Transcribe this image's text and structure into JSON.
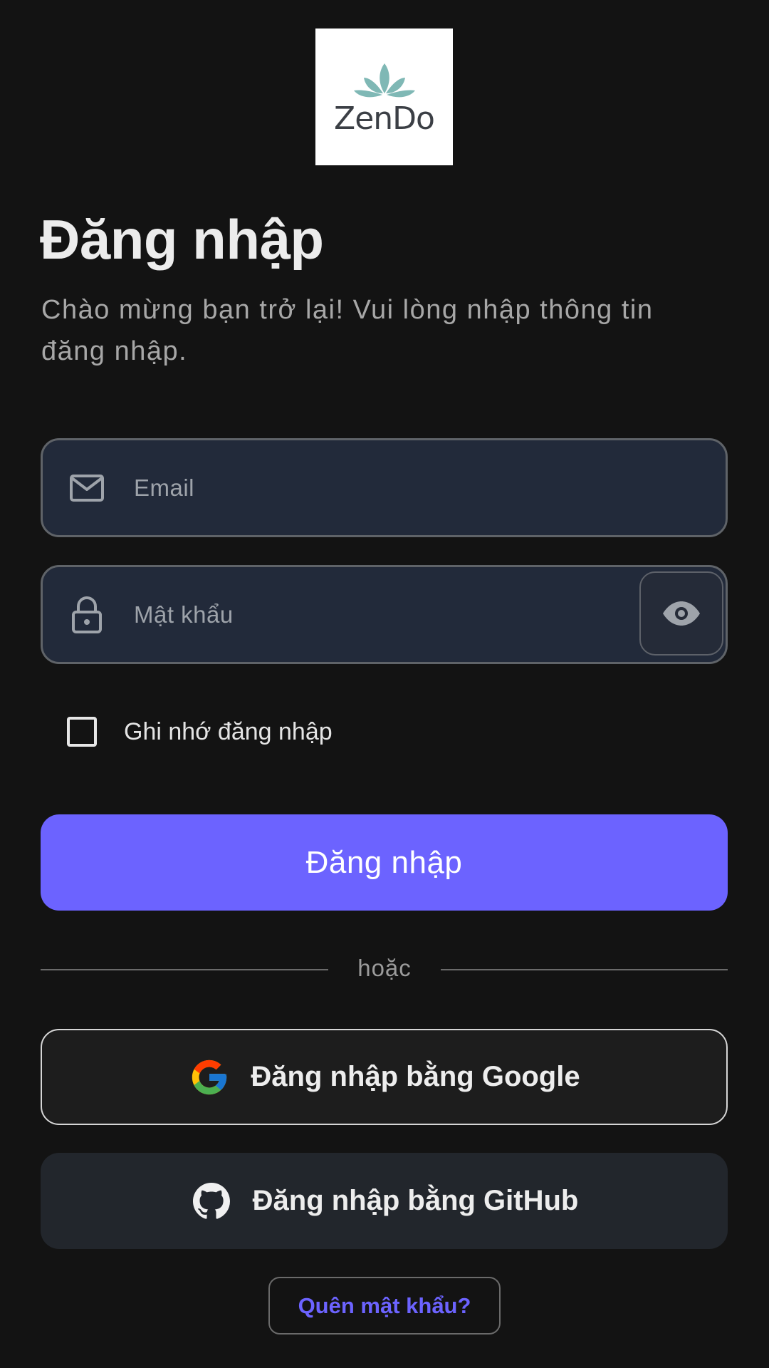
{
  "brand": {
    "name": "ZenDo"
  },
  "header": {
    "title": "Đăng nhập",
    "subtitle": "Chào mừng bạn trở lại! Vui lòng nhập thông tin đăng nhập."
  },
  "form": {
    "email": {
      "value": "",
      "placeholder": "Email"
    },
    "password": {
      "value": "",
      "placeholder": "Mật khẩu"
    },
    "remember_label": "Ghi nhớ đăng nhập",
    "remember_checked": false,
    "submit_label": "Đăng nhập"
  },
  "divider_text": "hoặc",
  "social": {
    "google_label": "Đăng nhập bằng Google",
    "github_label": "Đăng nhập bằng GitHub"
  },
  "forgot_label": "Quên mật khẩu?",
  "colors": {
    "background": "#131313",
    "accent": "#6c63ff",
    "field_bg": "#222a3a",
    "logo_teal": "#7fb8b5"
  }
}
